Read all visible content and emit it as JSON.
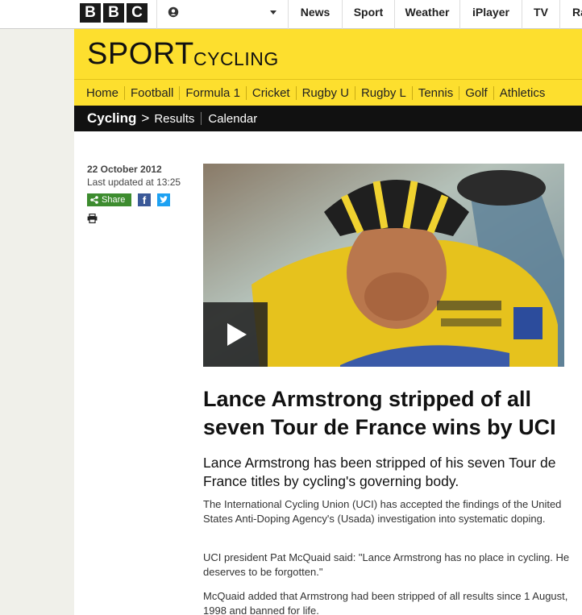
{
  "global_nav": {
    "logo": [
      "B",
      "B",
      "C"
    ],
    "account_icon": "user-icon",
    "more_icon": "caret-down-icon",
    "items": [
      "News",
      "Sport",
      "Weather",
      "iPlayer",
      "TV",
      "Ra"
    ]
  },
  "sport_header": {
    "title": "SPORT",
    "subtitle": "CYCLING",
    "nav": [
      "Home",
      "Football",
      "Formula 1",
      "Cricket",
      "Rugby U",
      "Rugby L",
      "Tennis",
      "Golf",
      "Athletics"
    ]
  },
  "sub_nav": {
    "section": "Cycling",
    "chevron": ">",
    "links": [
      "Results",
      "Calendar"
    ]
  },
  "meta": {
    "date": "22 October 2012",
    "updated": "Last updated at 13:25",
    "share_label": "Share",
    "icons": [
      "share-icon",
      "facebook-icon",
      "twitter-icon",
      "print-icon"
    ]
  },
  "article": {
    "headline": "Lance Armstrong stripped of all seven Tour de France wins by UCI",
    "intro": "Lance Armstrong has been stripped of his seven Tour de France titles by cycling's governing body.",
    "paragraphs": [
      "The International Cycling Union (UCI) has accepted the findings of the United States Anti-Doping Agency's (Usada) investigation into systematic doping.",
      "UCI president Pat McQuaid said: \"Lance Armstrong has no place in cycling. He deserves to be forgotten.\"",
      "McQuaid added that Armstrong had been stripped of all results since 1 August, 1998 and banned for life."
    ]
  },
  "colors": {
    "sport_yellow": "#fddf2e",
    "subnav_black": "#111111",
    "share_green": "#3d8c2f",
    "facebook_blue": "#3b5998",
    "twitter_blue": "#1da1f2"
  }
}
